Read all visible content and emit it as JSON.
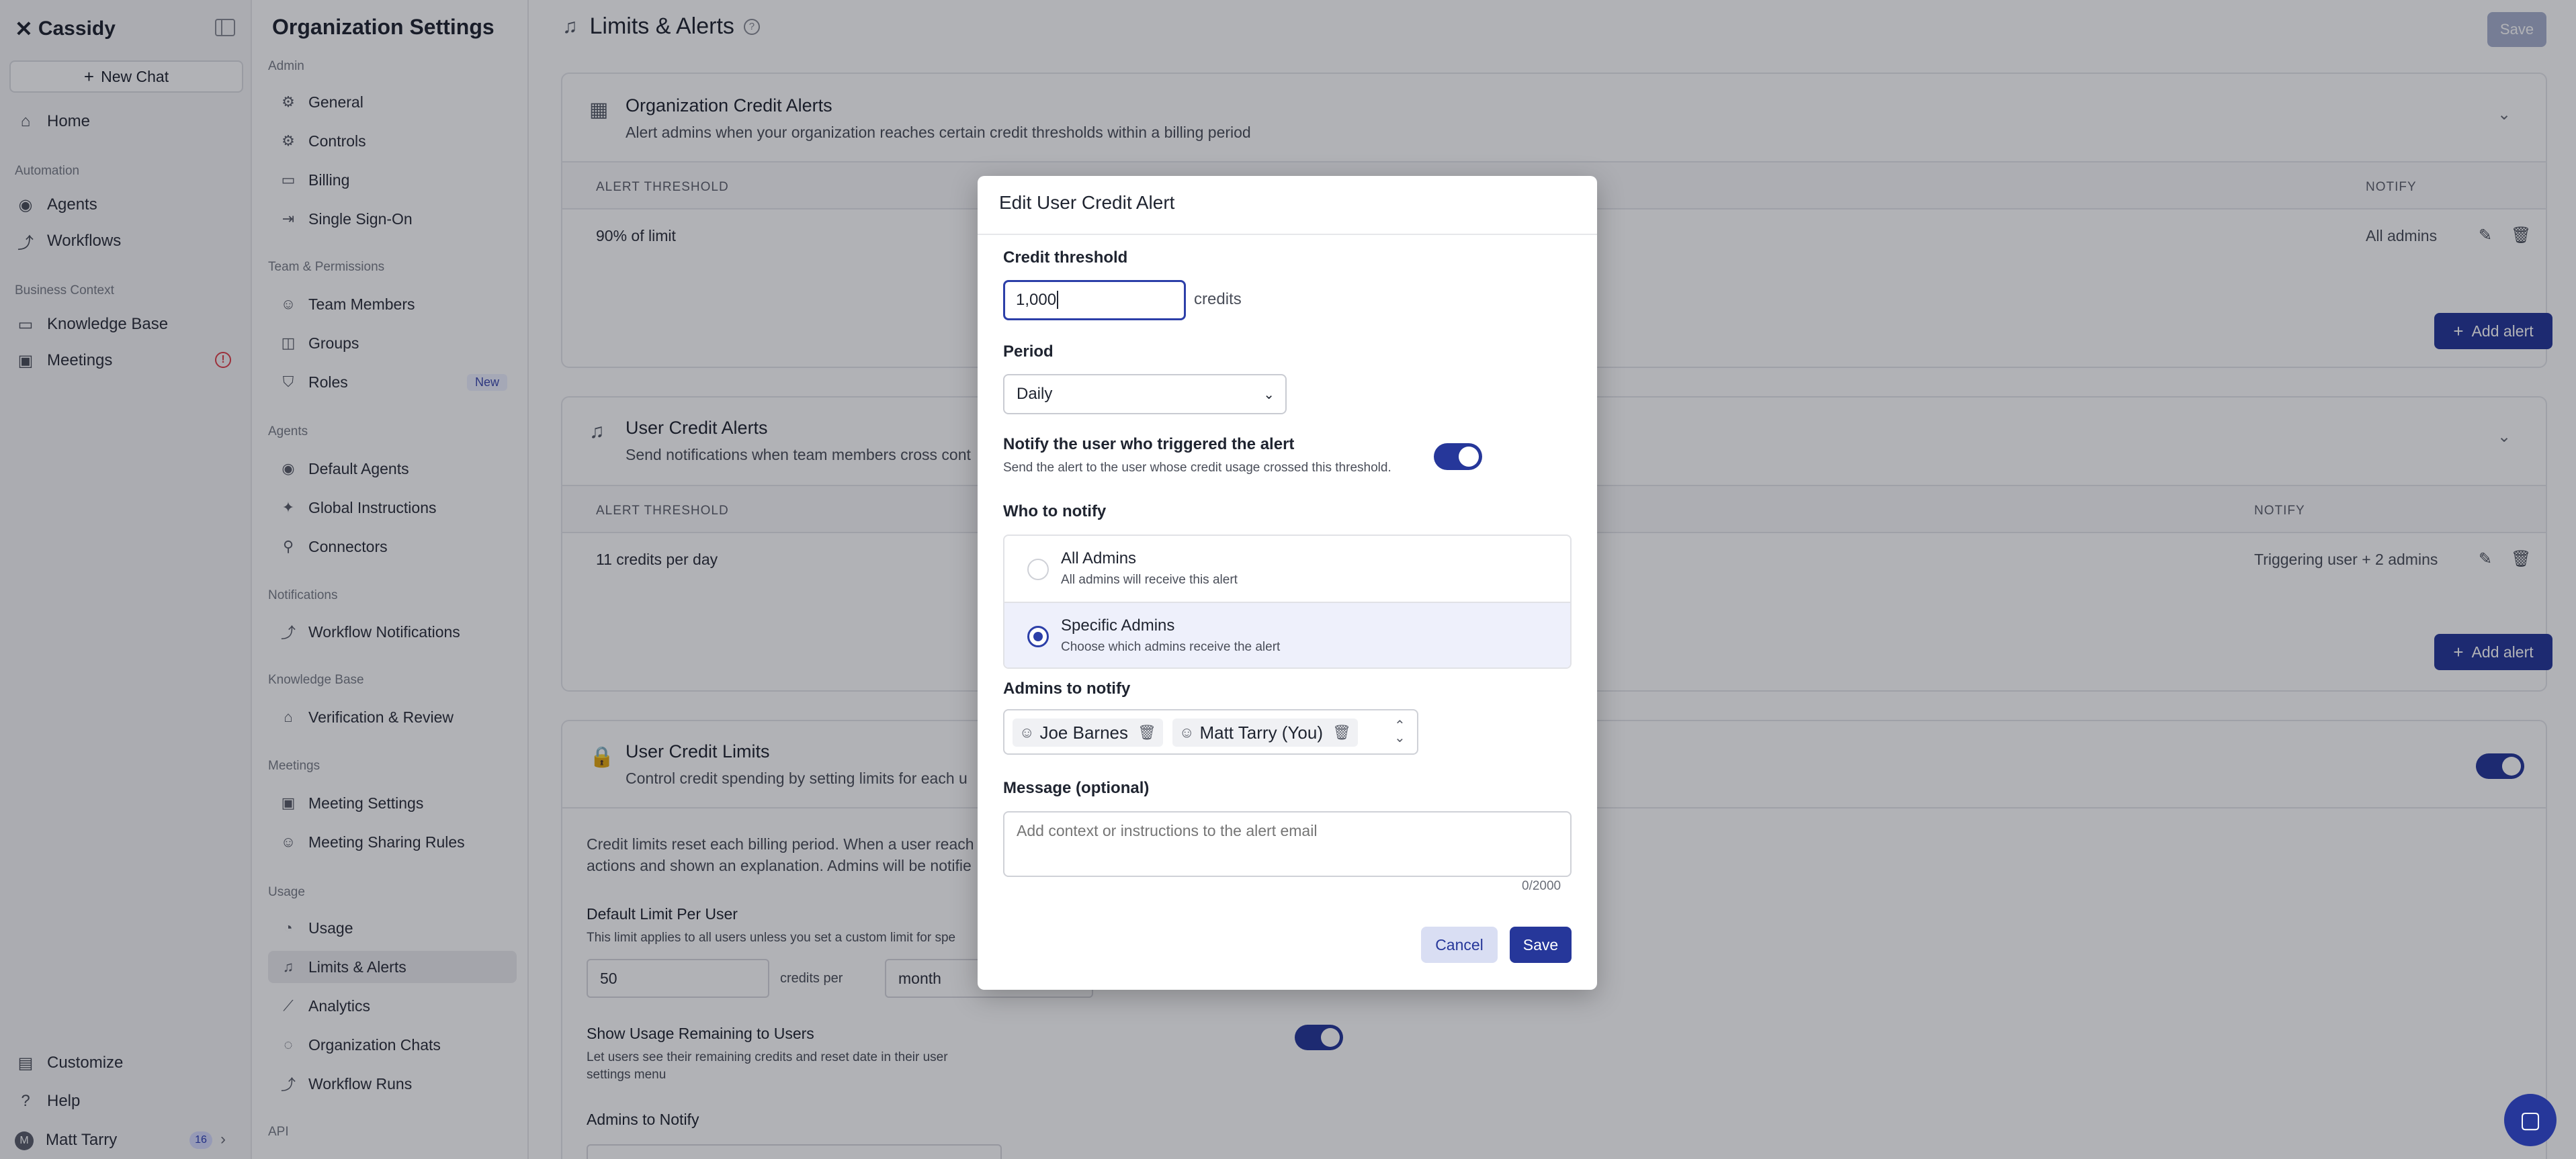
{
  "sidebar": {
    "brand": "Cassidy",
    "new_chat": "New Chat",
    "home": "Home",
    "section_automation": "Automation",
    "agents": "Agents",
    "workflows": "Workflows",
    "section_business": "Business Context",
    "knowledge_base": "Knowledge Base",
    "meetings": "Meetings",
    "customize": "Customize",
    "help": "Help",
    "user_initial": "M",
    "user_name": "Matt Tarry",
    "user_badge": "16"
  },
  "settings_nav": {
    "title": "Organization Settings",
    "sections": {
      "admin": "Admin",
      "team": "Team & Permissions",
      "agents": "Agents",
      "notifications": "Notifications",
      "knowledge": "Knowledge Base",
      "meetings": "Meetings",
      "usage": "Usage",
      "api": "API"
    },
    "items": {
      "general": "General",
      "controls": "Controls",
      "billing": "Billing",
      "sso": "Single Sign-On",
      "team_members": "Team Members",
      "groups": "Groups",
      "roles": "Roles",
      "roles_badge": "New",
      "default_agents": "Default Agents",
      "global_instructions": "Global Instructions",
      "connectors": "Connectors",
      "workflow_notifications": "Workflow Notifications",
      "verification": "Verification & Review",
      "meeting_settings": "Meeting Settings",
      "meeting_sharing": "Meeting Sharing Rules",
      "usage": "Usage",
      "limits_alerts": "Limits & Alerts",
      "analytics": "Analytics",
      "org_chats": "Organization Chats",
      "workflow_runs": "Workflow Runs"
    }
  },
  "main": {
    "title": "Limits & Alerts",
    "save": "Save",
    "org_alerts": {
      "title": "Organization Credit Alerts",
      "desc": "Alert admins when your organization reaches certain credit thresholds within a billing period",
      "col_threshold": "ALERT THRESHOLD",
      "col_notify": "NOTIFY",
      "row_threshold": "90% of limit",
      "row_notify": "All admins",
      "add": "Add alert"
    },
    "user_alerts": {
      "title": "User Credit Alerts",
      "desc": "Send notifications when team members cross cont",
      "col_threshold": "ALERT THRESHOLD",
      "col_notify": "NOTIFY",
      "row_threshold": "11 credits per day",
      "row_notify": "Triggering user + 2 admins",
      "add": "Add alert"
    },
    "user_limits": {
      "title": "User Credit Limits",
      "desc": "Control credit spending by setting limits for each u",
      "info_line1": "Credit limits reset each billing period. When a user reach",
      "info_line2": "actions and shown an explanation. Admins will be notifie",
      "default_label": "Default Limit Per User",
      "default_desc": "This limit applies to all users unless you set a custom limit for spe",
      "default_value": "50",
      "credits_per": "credits per",
      "period_value": "month",
      "show_label": "Show Usage Remaining to Users",
      "show_desc_1": "Let users see their remaining credits and reset date in their user",
      "show_desc_2": "settings menu",
      "admins_label": "Admins to Notify"
    }
  },
  "modal": {
    "title": "Edit User Credit Alert",
    "threshold_label": "Credit threshold",
    "threshold_value": "1,000",
    "threshold_unit": "credits",
    "period_label": "Period",
    "period_value": "Daily",
    "notify_user_label": "Notify the user who triggered the alert",
    "notify_user_desc": "Send the alert to the user whose credit usage crossed this threshold.",
    "who_label": "Who to notify",
    "opt_all_title": "All Admins",
    "opt_all_desc": "All admins will receive this alert",
    "opt_specific_title": "Specific Admins",
    "opt_specific_desc": "Choose which admins receive the alert",
    "admins_label": "Admins to notify",
    "admins": [
      "Joe Barnes",
      "Matt Tarry (You)"
    ],
    "message_label": "Message (optional)",
    "message_placeholder": "Add context or instructions to the alert email",
    "message_count": "0/2000",
    "cancel": "Cancel",
    "save": "Save"
  },
  "colors": {
    "primary": "#26379a",
    "overlay": "rgba(12,16,28,0.32)",
    "danger": "#e0404a"
  }
}
